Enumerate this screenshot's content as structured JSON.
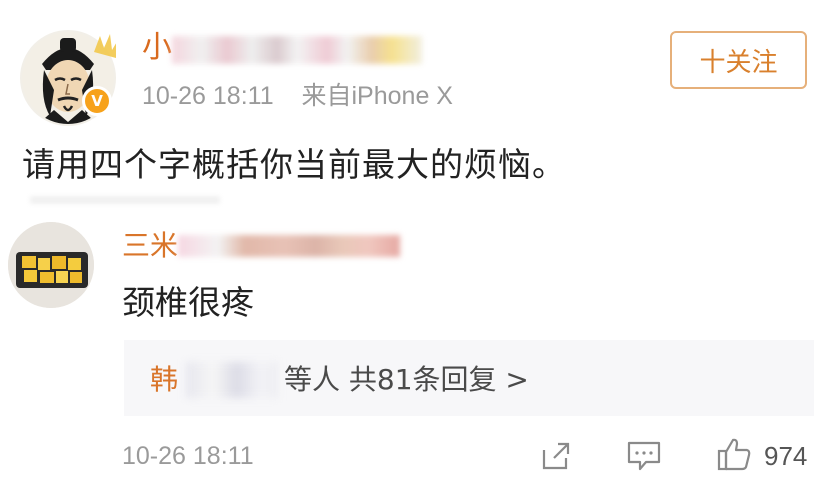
{
  "post": {
    "author_visible": "小",
    "time": "10-26 18:11",
    "source": "来自iPhone X",
    "follow_label": "十关注",
    "text": "请用四个字概括你当前最大的烦恼。"
  },
  "comment": {
    "author_visible": "三米",
    "text": "颈椎很疼",
    "replies": {
      "author_visible": "韩",
      "summary": "等人 共81条回复 >"
    },
    "time": "10-26 18:11",
    "likes": "974"
  },
  "icons": {
    "share": "share-icon",
    "reply": "comment-icon",
    "like": "thumbs-up-icon",
    "verified": "vip-badge-icon"
  },
  "colors": {
    "username": "#d96a1e",
    "follow_border": "#e6b07a",
    "follow_text": "#d9802d",
    "meta_text": "#9a9a9a",
    "replies_bg": "#f7f7f9"
  }
}
